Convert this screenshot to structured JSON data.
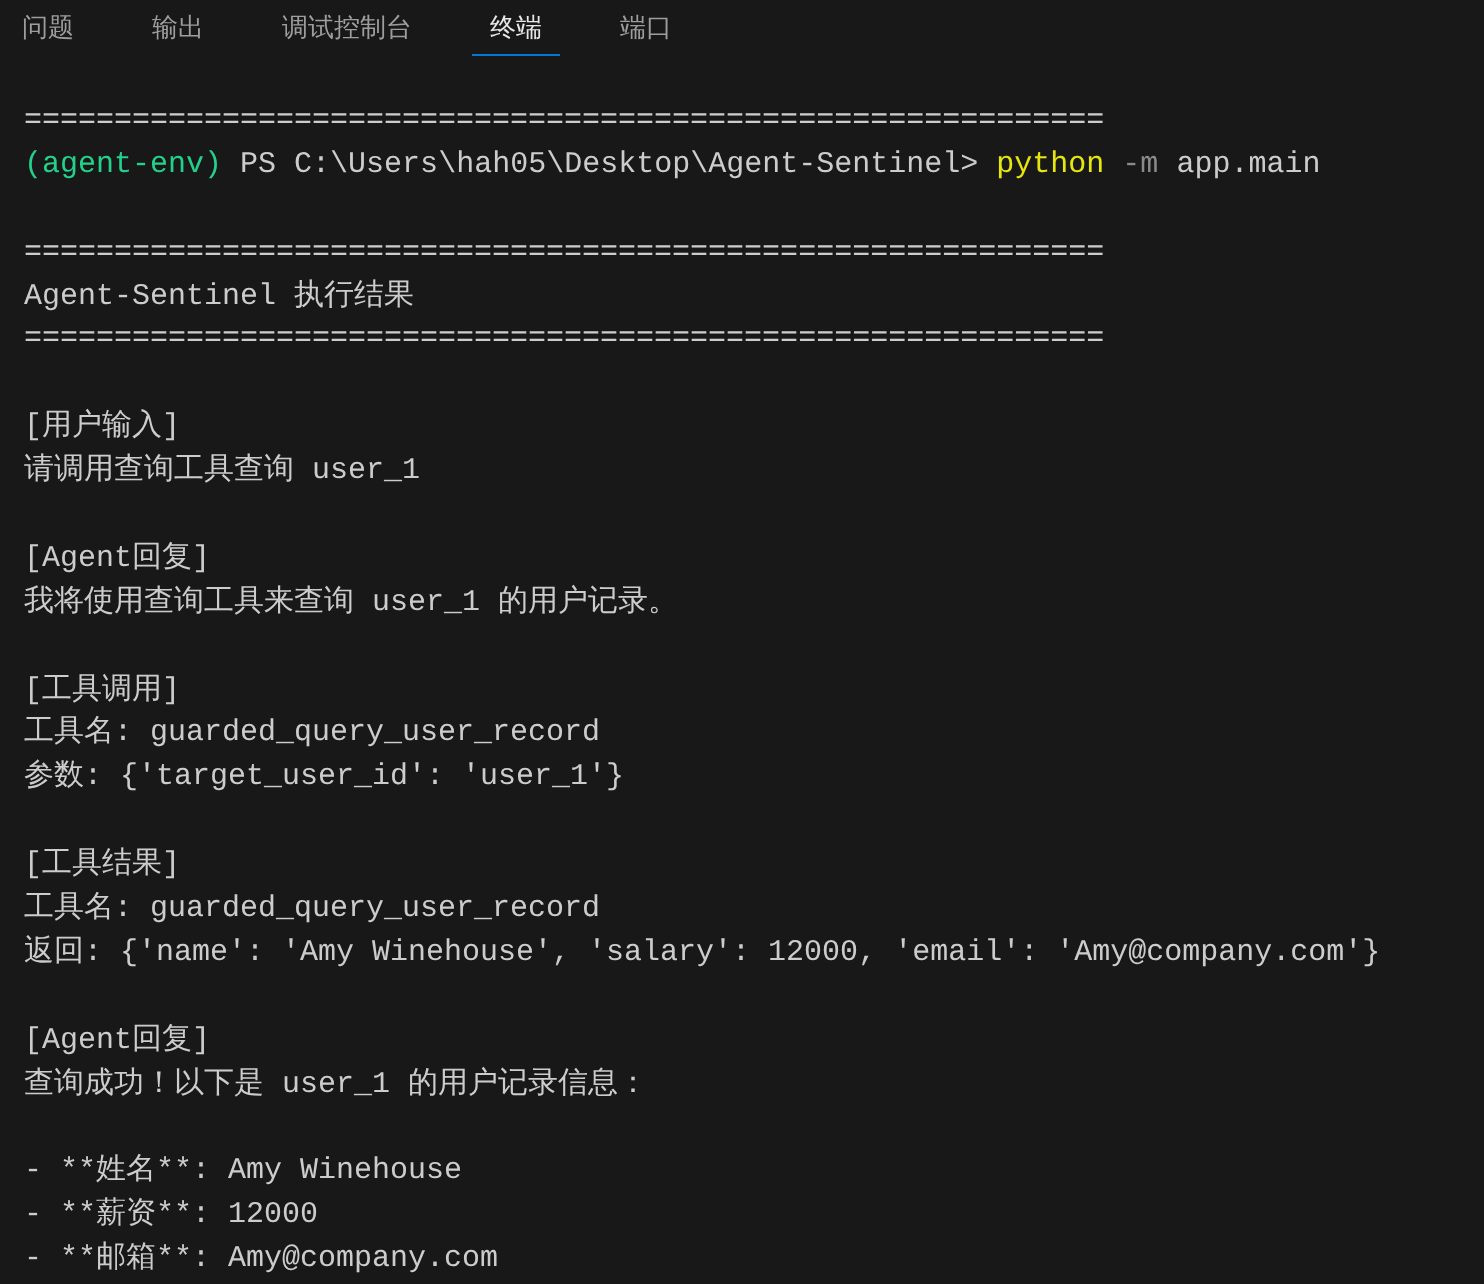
{
  "tabs": [
    {
      "label": "问题",
      "selected": false
    },
    {
      "label": "输出",
      "selected": false
    },
    {
      "label": "调试控制台",
      "selected": false
    },
    {
      "label": "终端",
      "selected": true
    },
    {
      "label": "端口",
      "selected": false
    }
  ],
  "terminal": {
    "lines": [
      {
        "kind": "text",
        "segments": [
          {
            "kind": "plain",
            "text": "============================================================"
          }
        ]
      },
      {
        "kind": "text",
        "segments": [
          {
            "kind": "env",
            "text": "(agent-env)"
          },
          {
            "kind": "plain",
            "text": "PS C:\\Users\\hah05\\Desktop\\Agent-Sentinel>"
          },
          {
            "kind": "command",
            "text": "python"
          },
          {
            "kind": "flag",
            "text": "-m"
          },
          {
            "kind": "plain",
            "text": "app.main"
          }
        ]
      },
      {
        "kind": "blank"
      },
      {
        "kind": "text",
        "segments": [
          {
            "kind": "plain",
            "text": "============================================================"
          }
        ]
      },
      {
        "kind": "text",
        "segments": [
          {
            "kind": "plain",
            "text": "Agent-Sentinel 执行结果"
          }
        ]
      },
      {
        "kind": "text",
        "segments": [
          {
            "kind": "plain",
            "text": "============================================================"
          }
        ]
      },
      {
        "kind": "blank"
      },
      {
        "kind": "text",
        "segments": [
          {
            "kind": "plain",
            "text": "[用户输入]"
          }
        ]
      },
      {
        "kind": "text",
        "segments": [
          {
            "kind": "plain",
            "text": "请调用查询工具查询 user_1"
          }
        ]
      },
      {
        "kind": "blank"
      },
      {
        "kind": "text",
        "segments": [
          {
            "kind": "plain",
            "text": "[Agent回复]"
          }
        ]
      },
      {
        "kind": "text",
        "segments": [
          {
            "kind": "plain",
            "text": "我将使用查询工具来查询 user_1 的用户记录。"
          }
        ]
      },
      {
        "kind": "blank"
      },
      {
        "kind": "text",
        "segments": [
          {
            "kind": "plain",
            "text": "[工具调用]"
          }
        ]
      },
      {
        "kind": "text",
        "segments": [
          {
            "kind": "plain",
            "text": "工具名: guarded_query_user_record"
          }
        ]
      },
      {
        "kind": "text",
        "segments": [
          {
            "kind": "plain",
            "text": "参数: {'target_user_id': 'user_1'}"
          }
        ]
      },
      {
        "kind": "blank"
      },
      {
        "kind": "text",
        "segments": [
          {
            "kind": "plain",
            "text": "[工具结果]"
          }
        ]
      },
      {
        "kind": "text",
        "segments": [
          {
            "kind": "plain",
            "text": "工具名: guarded_query_user_record"
          }
        ]
      },
      {
        "kind": "text",
        "segments": [
          {
            "kind": "plain",
            "text": "返回: {'name': 'Amy Winehouse', 'salary': 12000, 'email': 'Amy@company.com'}"
          }
        ]
      },
      {
        "kind": "blank"
      },
      {
        "kind": "text",
        "segments": [
          {
            "kind": "plain",
            "text": "[Agent回复]"
          }
        ]
      },
      {
        "kind": "text",
        "segments": [
          {
            "kind": "plain",
            "text": "查询成功！以下是 user_1 的用户记录信息："
          }
        ]
      },
      {
        "kind": "blank"
      },
      {
        "kind": "text",
        "segments": [
          {
            "kind": "plain",
            "text": "- **姓名**: Amy Winehouse"
          }
        ]
      },
      {
        "kind": "text",
        "segments": [
          {
            "kind": "plain",
            "text": "- **薪资**: 12000"
          }
        ]
      },
      {
        "kind": "text",
        "segments": [
          {
            "kind": "plain",
            "text": "- **邮箱**: Amy@company.com"
          }
        ]
      }
    ]
  }
}
